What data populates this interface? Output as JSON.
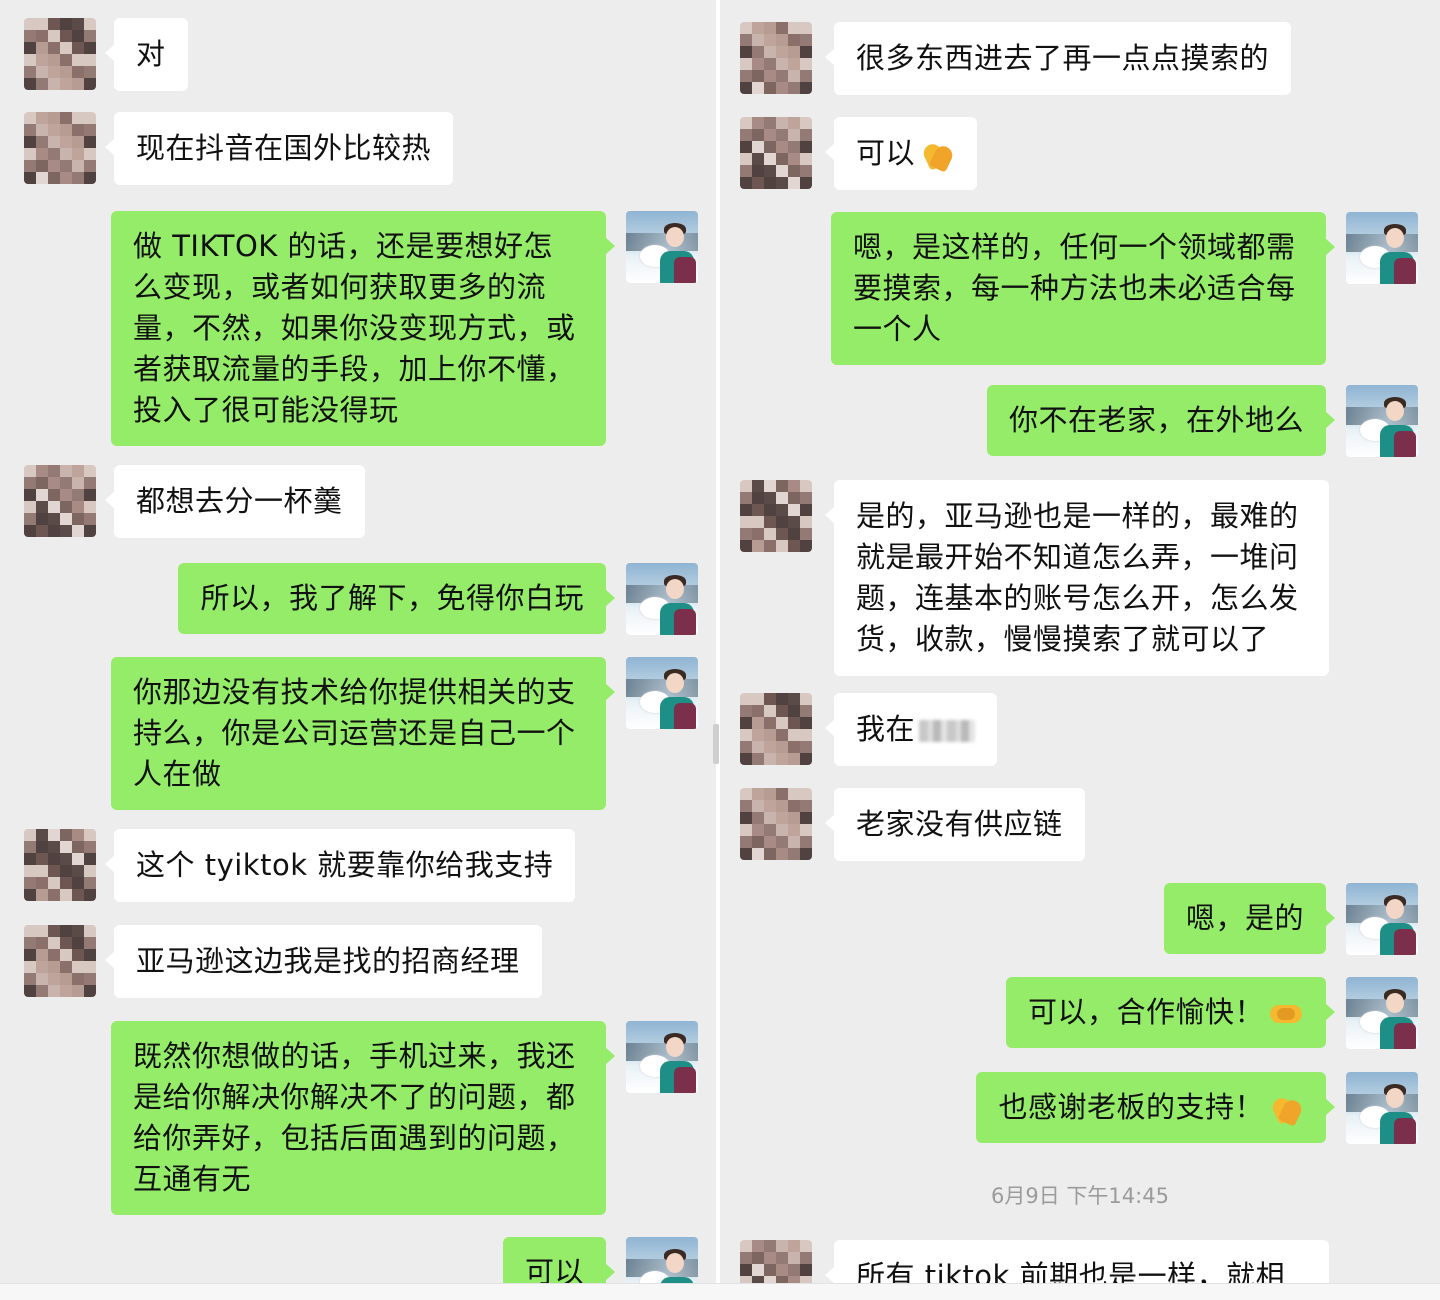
{
  "left_messages": [
    {
      "side": "in",
      "text": "对"
    },
    {
      "side": "in",
      "text": "现在抖音在国外比较热"
    },
    {
      "side": "out",
      "text": "做 TIKTOK 的话，还是要想好怎\n么变现，或者如何获取更多的流\n量，不然，如果你没变现方式，或\n者获取流量的手段，加上你不懂，\n投入了很可能没得玩"
    },
    {
      "side": "in",
      "text": "都想去分一杯羹"
    },
    {
      "side": "out",
      "text": "所以，我了解下，免得你白玩"
    },
    {
      "side": "out",
      "text": "你那边没有技术给你提供相关的支\n持么，你是公司运营还是自己一个\n人在做"
    },
    {
      "side": "in",
      "text": "这个 tyiktok 就要靠你给我支持"
    },
    {
      "side": "in",
      "text": "亚马逊这边我是找的招商经理"
    },
    {
      "side": "out",
      "text": "既然你想做的话，手机过来，我还\n是给你解决你解决不了的问题，都\n给你弄好，包括后面遇到的问题，\n互通有无"
    },
    {
      "side": "out",
      "text": "可以"
    }
  ],
  "right_messages": [
    {
      "side": "in",
      "text": "很多东西进去了再一点点摸索的"
    },
    {
      "side": "in",
      "text": "可以",
      "emoji": "folded-hands-emoji"
    },
    {
      "side": "out",
      "text": "嗯，是这样的，任何一个领域都需\n要摸索，每一种方法也未必适合每\n一个人"
    },
    {
      "side": "out",
      "text": "你不在老家，在外地么"
    },
    {
      "side": "in",
      "text": "是的，亚马逊也是一样的，最难的\n就是最开始不知道怎么弄，一堆问\n题，连基本的账号怎么开，怎么发\n货，收款，慢慢摸索了就可以了"
    },
    {
      "side": "in",
      "text": "我在",
      "redacted": true
    },
    {
      "side": "in",
      "text": "老家没有供应链"
    },
    {
      "side": "out",
      "text": "嗯，是的"
    },
    {
      "side": "out",
      "text": "可以，合作愉快！",
      "emoji": "handshake-emoji"
    },
    {
      "side": "out",
      "text": "也感谢老板的支持！",
      "emoji": "folded-hands-emoji"
    }
  ],
  "timestamp": "6月9日 下午14:45",
  "after_timestamp_message": {
    "side": "in",
    "text": "所有 tiktok 前期也是一样，就相"
  },
  "colors": {
    "background": "#ededed",
    "incoming_bubble": "#ffffff",
    "outgoing_bubble": "#95ec69",
    "timestamp_text": "#9b9b9b"
  }
}
